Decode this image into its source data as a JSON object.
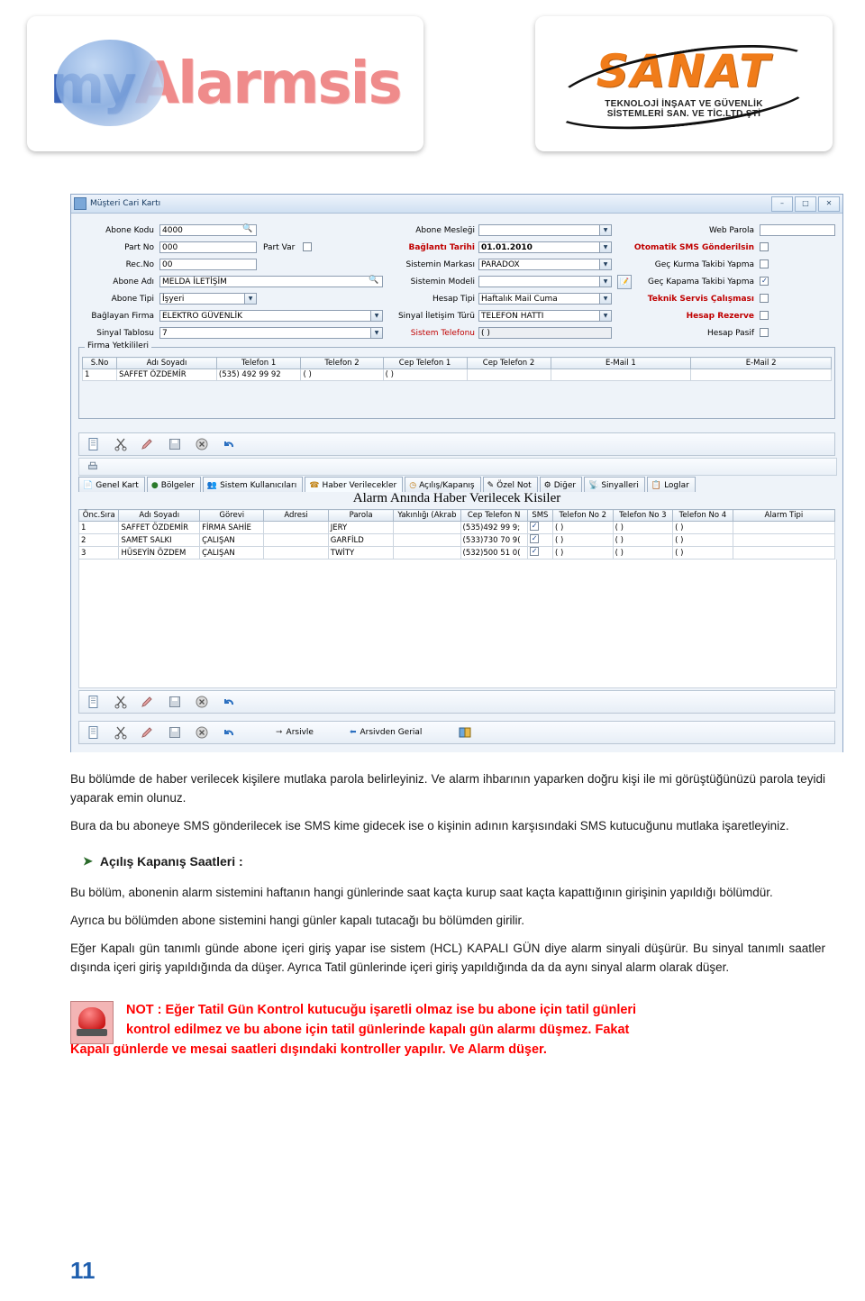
{
  "logos": {
    "my_prefix": "my",
    "my_word": "Alarmsis",
    "sanat_word": "SANAT",
    "sanat_line1": "TEKNOLOJİ İNŞAAT VE GÜVENLİK",
    "sanat_line2": "SİSTEMLERİ SAN. VE TİC.LTD.ŞTİ"
  },
  "screenshot": {
    "title": "Müşteri Cari Kartı",
    "window_buttons": [
      "–",
      "□",
      "✕"
    ],
    "left_fields": [
      {
        "label": "Abone Kodu",
        "value": "4000"
      },
      {
        "label": "Part No",
        "value": "000"
      },
      {
        "label": "Rec.No",
        "value": "00"
      },
      {
        "label": "Abone Adı",
        "value": "MELDA İLETİŞİM"
      },
      {
        "label": "Abone Tipi",
        "value": "İşyeri"
      },
      {
        "label": "Bağlayan Firma",
        "value": "ELEKTRO GÜVENLİK"
      },
      {
        "label": "Sinyal Tablosu",
        "value": "7"
      }
    ],
    "part_var_label": "Part Var",
    "mid_fields": [
      {
        "label": "Abone Mesleği",
        "value": ""
      },
      {
        "label": "Bağlantı Tarihi",
        "value": "01.01.2010"
      },
      {
        "label": "Sistemin Markası",
        "value": "PARADOX"
      },
      {
        "label": "Sistemin Modeli",
        "value": ""
      },
      {
        "label": "Hesap Tipi",
        "value": "Haftalık Mail Cuma"
      },
      {
        "label": "Sinyal İletişim Türü",
        "value": "TELEFON HATTI"
      },
      {
        "label": "Sistem Telefonu",
        "value": "(   )"
      }
    ],
    "right_fields": [
      {
        "label": "Web Parola",
        "value": "",
        "type": "text"
      },
      {
        "label": "Otomatik SMS Gönderilsin",
        "checked": false,
        "red": true
      },
      {
        "label": "Geç Kurma Takibi Yapma",
        "checked": false
      },
      {
        "label": "Geç Kapama Takibi Yapma",
        "checked": true
      },
      {
        "label": "Teknik Servis Çalışması",
        "checked": false,
        "red": true
      },
      {
        "label": "Hesap Rezerve",
        "checked": false,
        "red": true
      },
      {
        "label": "Hesap Pasif",
        "checked": false
      }
    ],
    "firma_group_caption": "Firma Yetkilileri",
    "firma_headers": [
      "S.No",
      "Adı Soyadı",
      "Telefon 1",
      "Telefon 2",
      "Cep Telefon 1",
      "Cep Telefon 2",
      "E-Mail 1",
      "E-Mail 2"
    ],
    "firma_rows": [
      [
        "1",
        "SAFFET ÖZDEMİR",
        "(535) 492 99 92",
        "(   )",
        "(   )",
        "",
        ""
      ]
    ],
    "tabs": [
      {
        "label": "Genel Kart",
        "icon": "page-icon"
      },
      {
        "label": "Bölgeler",
        "icon": "globe-icon"
      },
      {
        "label": "Sistem Kullanıcıları",
        "icon": "users-icon"
      },
      {
        "label": "Haber Verilecekler",
        "icon": "phone-icon",
        "active": true
      },
      {
        "label": "Açılış/Kapanış",
        "icon": "clock-icon"
      },
      {
        "label": "Özel Not",
        "icon": "note-icon"
      },
      {
        "label": "Diğer",
        "icon": "other-icon"
      },
      {
        "label": "Sinyalleri",
        "icon": "signal-icon"
      },
      {
        "label": "Loglar",
        "icon": "log-icon"
      }
    ],
    "banner": "Alarm Anında Haber Verilecek Kisiler",
    "haber_headers": [
      "Önc.Sıra",
      "Adı Soyadı",
      "Görevi",
      "Adresi",
      "Parola",
      "Yakınlığı (Akrab",
      "Cep Telefon N",
      "SMS",
      "Telefon No 2",
      "Telefon  No 3",
      "Telefon No 4",
      "Alarm Tipi"
    ],
    "haber_rows": [
      {
        "cells": [
          "1",
          "SAFFET ÖZDEMİR",
          "FİRMA SAHİE",
          "",
          "JERY",
          "",
          "(535)492 99 9;",
          "",
          "(   )",
          "(   )",
          "(   )",
          ""
        ],
        "sms": true
      },
      {
        "cells": [
          "2",
          "SAMET SALKI",
          "ÇALIŞAN",
          "",
          "GARFİLD",
          "",
          "(533)730 70 9(",
          "",
          "(   )",
          "(   )",
          "(   )",
          ""
        ],
        "sms": true
      },
      {
        "cells": [
          "3",
          "HÜSEYİN ÖZDEM",
          "ÇALIŞAN",
          "",
          "TWİTY",
          "",
          "(532)500 51 0(",
          "",
          "(   )",
          "(   )",
          "(   )",
          ""
        ],
        "sms": true
      }
    ],
    "bottom_buttons": [
      {
        "label": "Arsivle",
        "icon": "archive-icon"
      },
      {
        "label": "Arsivden Gerial",
        "icon": "restore-icon"
      }
    ],
    "toolbar_icons": [
      "new-icon",
      "cut-icon",
      "edit-icon",
      "save-icon",
      "delete-icon",
      "undo-icon"
    ]
  },
  "body": {
    "p1": "Bu bölümde de haber verilecek kişilere mutlaka parola belirleyiniz. Ve alarm ihbarının yaparken doğru kişi ile mi görüştüğünüzü parola teyidi yaparak emin olunuz.",
    "p2": "Bura da bu aboneye  SMS gönderilecek ise SMS kime gidecek ise o kişinin adının karşısındaki SMS kutucuğunu mutlaka işaretleyiniz.",
    "heading": "Açılış Kapanış Saatleri :",
    "p3": "Bu bölüm,  abonenin alarm sistemini haftanın hangi günlerinde saat kaçta kurup saat kaçta kapattığının girişinin yapıldığı bölümdür.",
    "p4": "Ayrıca bu bölümden abone sistemini hangi günler kapalı tutacağı bu bölümden girilir.",
    "p5": "Eğer Kapalı gün tanımlı günde abone içeri giriş yapar ise sistem (HCL) KAPALI GÜN diye alarm sinyali düşürür. Bu sinyal tanımlı saatler dışında içeri giriş yapıldığında da düşer. Ayrıca Tatil günlerinde içeri giriş yapıldığında da da aynı sinyal alarm olarak düşer.",
    "note_line1": "NOT : Eğer Tatil Gün Kontrol  kutucuğu işaretli olmaz ise bu abone için tatil günleri",
    "note_line2": "kontrol edilmez ve bu abone için tatil günlerinde kapalı gün alarmı düşmez. Fakat",
    "note_line3": "Kapalı günlerde ve mesai saatleri dışındaki kontroller yapılır. Ve Alarm düşer.",
    "page_number": "11"
  }
}
